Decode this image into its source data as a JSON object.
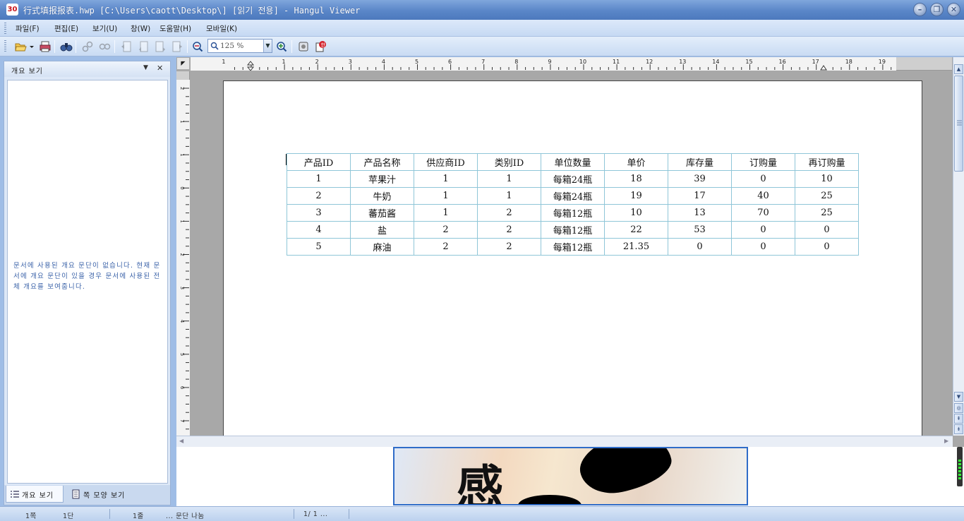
{
  "window": {
    "title": "行式填报报表.hwp [C:\\Users\\caott\\Desktop\\] [읽기 전용] - Hangul Viewer",
    "app_icon_label": "30"
  },
  "menu": {
    "items": [
      "파일(F)",
      "편집(E)",
      "보기(U)",
      "창(W)",
      "도움말(H)",
      "모바일(K)"
    ]
  },
  "toolbar": {
    "zoom_value": "125 %"
  },
  "panel": {
    "title": "개요 보기",
    "message": "문서에 사용된 개요 문단이 없습니다. 현재 문서에 개요 문단이 있을 경우 문서에 사용된 전체 개요를 보여줍니다.",
    "tabs": [
      "개요 보기",
      "쪽 모양 보기"
    ]
  },
  "ruler": {
    "h_labels": [
      "1",
      "1",
      "2",
      "3",
      "4",
      "5",
      "6",
      "7",
      "8",
      "9",
      "10",
      "11",
      "12",
      "13",
      "14",
      "15",
      "16",
      "17",
      "18",
      "19"
    ],
    "v_labels": [
      "2",
      "1",
      "1",
      "0",
      "1",
      "2",
      "3",
      "4",
      "5",
      "6",
      "7",
      "8"
    ]
  },
  "document": {
    "table": {
      "headers": [
        "产品ID",
        "产品名称",
        "供应商ID",
        "类别ID",
        "单位数量",
        "单价",
        "库存量",
        "订购量",
        "再订购量"
      ],
      "rows": [
        [
          "1",
          "苹果汁",
          "1",
          "1",
          "每箱24瓶",
          "18",
          "39",
          "0",
          "10"
        ],
        [
          "2",
          "牛奶",
          "1",
          "1",
          "每箱24瓶",
          "19",
          "17",
          "40",
          "25"
        ],
        [
          "3",
          "蕃茄酱",
          "1",
          "2",
          "每箱12瓶",
          "10",
          "13",
          "70",
          "25"
        ],
        [
          "4",
          "盐",
          "2",
          "2",
          "每箱12瓶",
          "22",
          "53",
          "0",
          "0"
        ],
        [
          "5",
          "麻油",
          "2",
          "2",
          "每箱12瓶",
          "21.35",
          "0",
          "0",
          "0"
        ]
      ]
    }
  },
  "banner": {
    "glyph": "感"
  },
  "status": {
    "page": "1쪽",
    "section": "1단",
    "line": "1줄",
    "mode": "... 문단 나눔",
    "pages": "1/  1 ..."
  },
  "colors": {
    "title_bar": "#5a86c8",
    "menu_bg": "#d3e2f6",
    "table_border": "#8fc6d8",
    "panel_message": "#3a62a8"
  }
}
